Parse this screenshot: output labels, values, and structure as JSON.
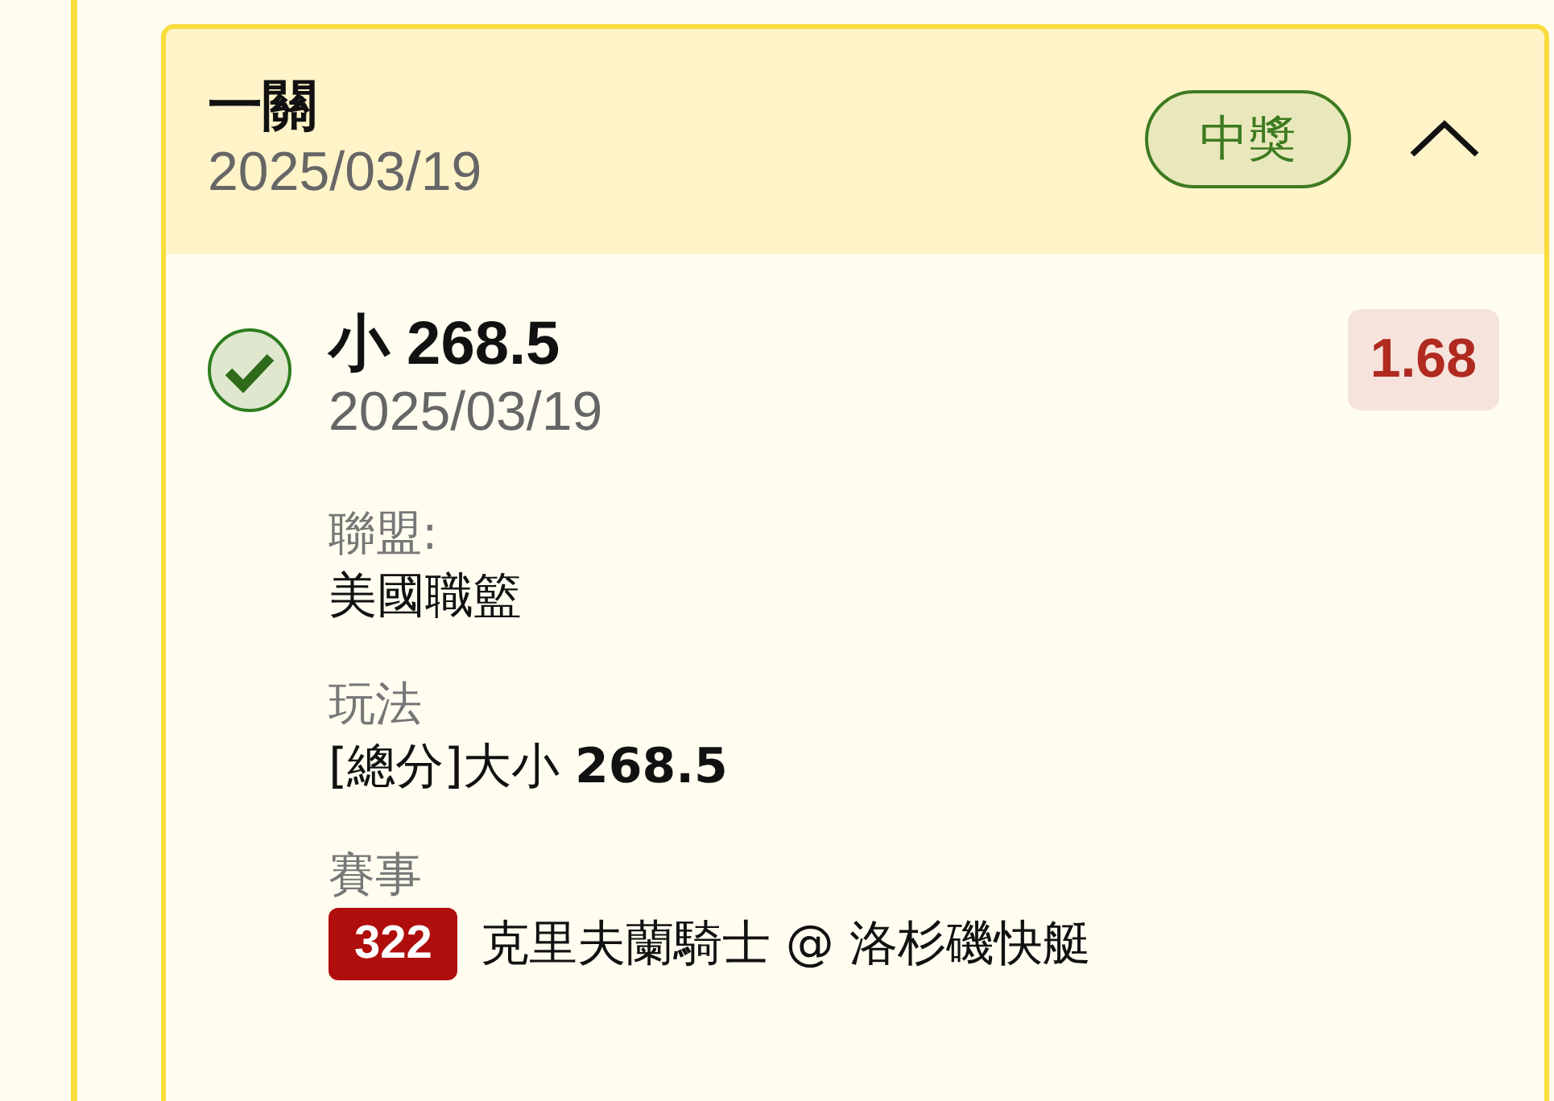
{
  "ticket": {
    "title": "一關",
    "date": "2025/03/19",
    "status": {
      "label": "中獎",
      "kind": "won"
    },
    "expanded": true
  },
  "bet": {
    "won": true,
    "selection": "小 268.5",
    "date": "2025/03/19",
    "odds": "1.68",
    "fields": [
      {
        "label": "聯盟:",
        "value": "美國職籃"
      },
      {
        "label": "玩法",
        "value": "[總分]大小 **268.5**"
      }
    ],
    "event": {
      "label": "賽事",
      "number": "322",
      "match": "克里夫蘭騎士 @ 洛杉磯快艇"
    }
  }
}
